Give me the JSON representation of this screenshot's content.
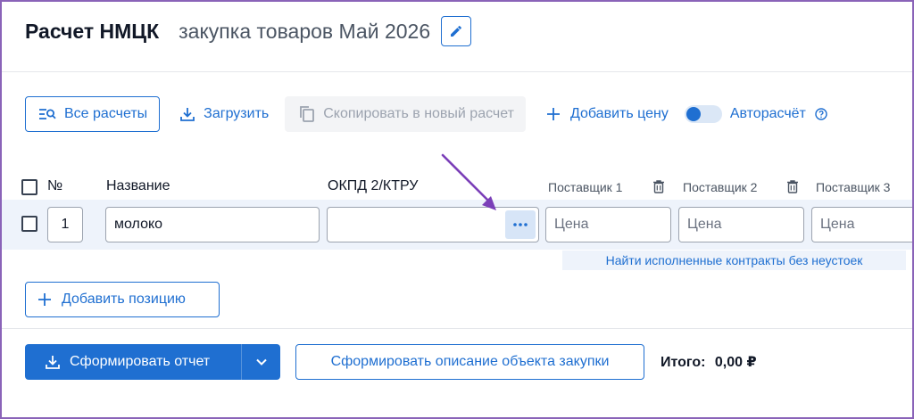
{
  "header": {
    "title": "Расчет НМЦК",
    "subtitle": "закупка товаров Май 2026",
    "edit_icon": "pencil-icon"
  },
  "toolbar": {
    "all_calcs_label": "Все расчеты",
    "upload_label": "Загрузить",
    "copy_label": "Скопировать в новый расчет",
    "add_price_label": "Добавить цену",
    "autocalc_label": "Авторасчёт",
    "autocalc_enabled": true
  },
  "table": {
    "headers": {
      "number": "№",
      "name": "Название",
      "okpd": "ОКПД 2/КТРУ"
    },
    "suppliers": [
      "Поставщик 1",
      "Поставщик 2",
      "Поставщик 3"
    ],
    "rows": [
      {
        "number": "1",
        "name": "молоко",
        "okpd": "",
        "price_placeholder": "Цена"
      }
    ]
  },
  "hint": "Найти исполненные контракты без неустоек",
  "add_position_label": "Добавить позицию",
  "footer": {
    "generate_report_label": "Сформировать отчет",
    "generate_description_label": "Сформировать описание объекта закупки",
    "total_label": "Итого:",
    "total_value": "0,00 ₽"
  },
  "colors": {
    "accent": "#1f6fd1",
    "row_highlight": "#eef3fb",
    "annotation_arrow": "#7b3fb8"
  }
}
